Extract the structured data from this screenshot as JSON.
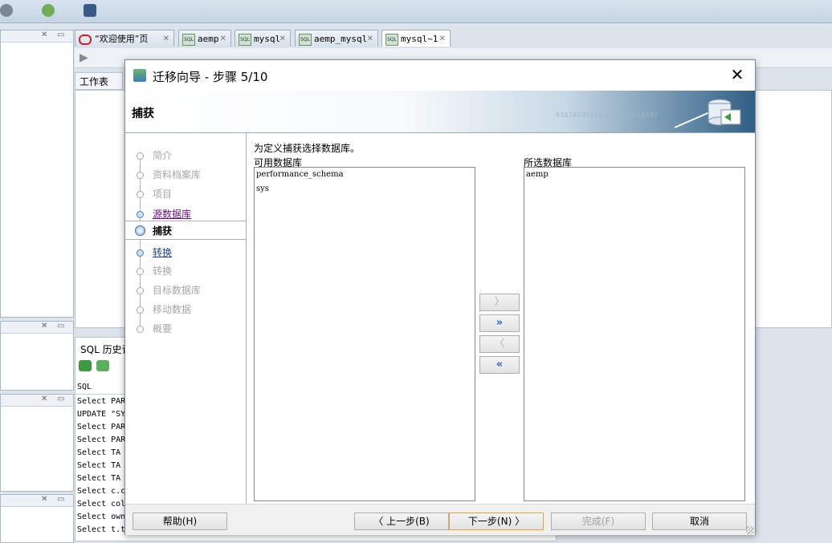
{
  "editor_tabs": [
    {
      "label": "“欢迎使用”页",
      "icon": "oracle-icon"
    },
    {
      "label": "aemp",
      "icon": "sql-worksheet-icon"
    },
    {
      "label": "mysql",
      "icon": "sql-worksheet-icon"
    },
    {
      "label": "aemp_mysql",
      "icon": "sql-worksheet-icon"
    },
    {
      "label": "mysql~1",
      "icon": "sql-worksheet-icon"
    }
  ],
  "sql_icon_text": "SQL",
  "worksheet_tab": "工作表",
  "sql_history": {
    "title": "SQL 历史记",
    "column": "SQL",
    "rows": [
      "Select PAR",
      "UPDATE \"SY",
      "Select PAR",
      "Select PAR",
      "Select  TA",
      "Select  TA",
      "Select  TA",
      "Select c.c",
      "Select col",
      "Select own",
      "Select t.t"
    ]
  },
  "dialog": {
    "title": "迁移向导 - 步骤 5/10",
    "close_glyph": "✕",
    "banner_title": "捕获",
    "banner_pattern": "010101010101010101010101",
    "steps": [
      {
        "label": "简介",
        "state": "disabled"
      },
      {
        "label": "资料档案库",
        "state": "disabled"
      },
      {
        "label": "项目",
        "state": "disabled"
      },
      {
        "label": "源数据库",
        "state": "visited"
      },
      {
        "label": "捕获",
        "state": "current"
      },
      {
        "label": "转换",
        "state": "link"
      },
      {
        "label": "转换",
        "state": "disabled"
      },
      {
        "label": "目标数据库",
        "state": "disabled"
      },
      {
        "label": "移动数据",
        "state": "disabled"
      },
      {
        "label": "概要",
        "state": "disabled"
      }
    ],
    "instruction": "为定义捕获选择数据库。",
    "available_label": "可用数据库",
    "selected_label": "所选数据库",
    "available_items": [
      "performance_schema",
      "sys"
    ],
    "selected_items": [
      "aemp"
    ],
    "move_buttons": {
      "add_one": "〉",
      "add_all": "»",
      "remove_one": "〈",
      "remove_all": "«"
    },
    "footer": {
      "help": "帮助(H)",
      "back": "〈 上一步(B)",
      "next": "下一步(N) 〉",
      "finish": "完成(F)",
      "cancel": "取消"
    }
  },
  "colors": {
    "link": "#1c3f9a",
    "visited": "#6a0f7c",
    "default_button_border": "#e8a532",
    "accent_blue": "#2a64c5"
  }
}
